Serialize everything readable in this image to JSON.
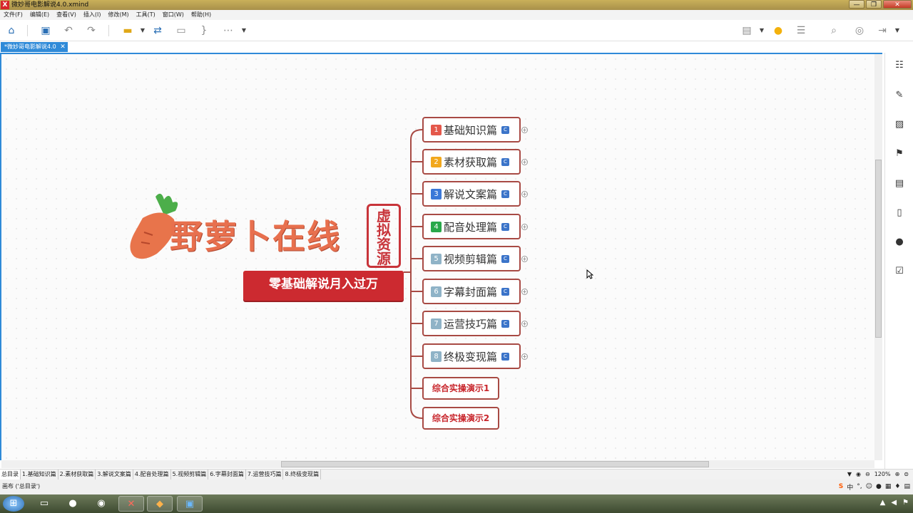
{
  "window": {
    "title": "微妙哥电影解说4.0.xmind",
    "app_icon": "X"
  },
  "menu": [
    "文件(F)",
    "编辑(E)",
    "查看(V)",
    "插入(I)",
    "修改(M)",
    "工具(T)",
    "窗口(W)",
    "帮助(H)"
  ],
  "tab": {
    "label": "*微妙哥电影解说4.0"
  },
  "logo": {
    "text": "野萝卜在线",
    "seal": [
      "虚",
      "拟",
      "资",
      "源"
    ],
    "slogan": "零基础解说月入过万"
  },
  "branches": [
    {
      "num": "1",
      "label": "基础知识篇",
      "color": "#e4584b"
    },
    {
      "num": "2",
      "label": "素材获取篇",
      "color": "#f2a81d"
    },
    {
      "num": "3",
      "label": "解说文案篇",
      "color": "#3b78d8"
    },
    {
      "num": "4",
      "label": "配音处理篇",
      "color": "#29a84a"
    },
    {
      "num": "5",
      "label": "视频剪辑篇",
      "color": "#8fb3c7"
    },
    {
      "num": "6",
      "label": "字幕封面篇",
      "color": "#8fb3c7"
    },
    {
      "num": "7",
      "label": "运营技巧篇",
      "color": "#8fb3c7"
    },
    {
      "num": "8",
      "label": "终极变现篇",
      "color": "#8fb3c7"
    }
  ],
  "demos": [
    "综合实操演示1",
    "综合实操演示2"
  ],
  "link_badge": "C",
  "expand_glyph": "+",
  "sheets": [
    "总目录",
    "1.基础知识篇",
    "2.素材获取篇",
    "3.解说文案篇",
    "4.配音处理篇",
    "5.视频剪辑篇",
    "6.字幕封面篇",
    "7.运营技巧篇",
    "8.终极变现篇"
  ],
  "zoom": "120%",
  "status": "画布 ('总目录')",
  "ime": {
    "brand": "S",
    "mode": "中"
  }
}
